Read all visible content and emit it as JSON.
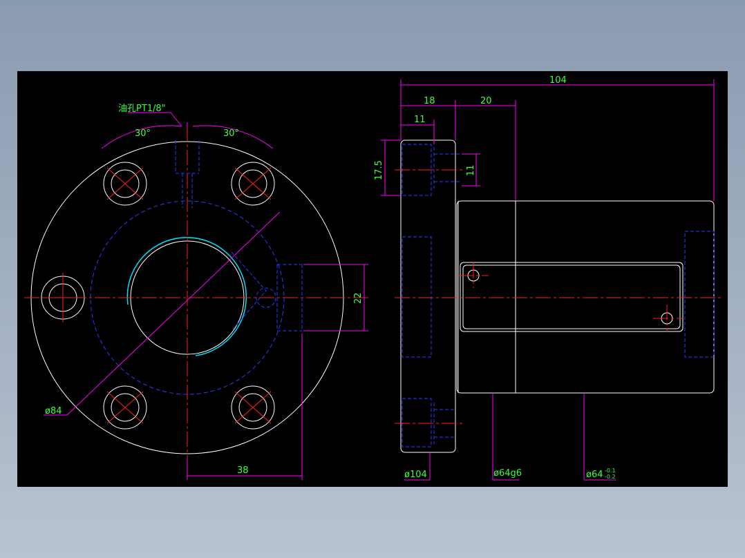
{
  "drawing": {
    "front_view": {
      "oil_hole_label": "油孔PT1/8\"",
      "angle_left": "30°",
      "angle_right": "30°",
      "pcd_dim": "ø84",
      "offset_dim": "38",
      "port_dim": "22"
    },
    "side_view": {
      "overall_length": "104",
      "flange_width": "18",
      "dim_20": "20",
      "dim_11_top": "11",
      "dim_17_5": "17.5",
      "dim_11_vertical": "11",
      "flange_diameter": "ø104",
      "pilot_diameter": "ø64g6",
      "body_diameter": "ø64",
      "tol_upper": "-0.1",
      "tol_lower": "-0.2"
    }
  },
  "colors": {
    "background": "#000000",
    "outline": "#ffffff",
    "hidden": "#2a3cff",
    "center": "#ff2020",
    "dimension": "#ff00ff",
    "text": "#3cff3c",
    "thread": "#00e0ff"
  }
}
